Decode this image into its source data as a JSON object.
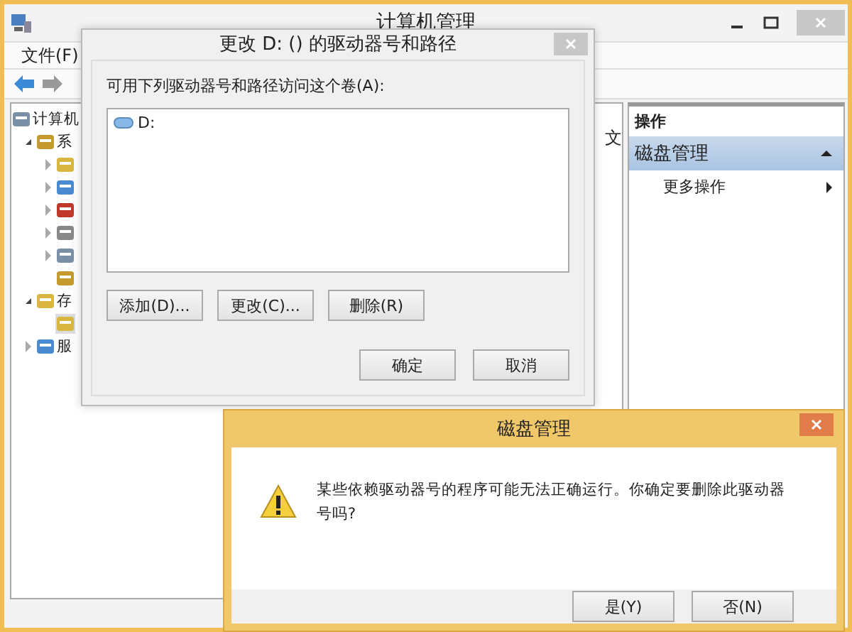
{
  "window": {
    "title": "计算机管理"
  },
  "menu": [
    "文件(F)"
  ],
  "tree": [
    {
      "label": "计算机",
      "children": [
        {
          "label": "系",
          "expanded": true,
          "children": [
            {
              "expanded": false
            },
            {
              "expanded": false
            },
            {
              "expanded": false
            },
            {
              "expanded": false
            },
            {
              "expanded": false
            },
            {
              "selected": false
            }
          ]
        },
        {
          "label": "存",
          "expanded": true,
          "children": [
            {
              "selected": true
            }
          ]
        },
        {
          "label": "服",
          "expanded": false
        }
      ]
    }
  ],
  "middle_text": "文",
  "actions": {
    "header": "操作",
    "section": "磁盘管理",
    "expanded": true,
    "items": [
      "更多操作"
    ]
  },
  "drive_dialog": {
    "title": "更改 D: () 的驱动器号和路径",
    "label": "可用下列驱动器号和路径访问这个卷(A):",
    "entries": [
      {
        "label": "D:",
        "selected": false
      }
    ],
    "buttons": [
      "添加(D)...",
      "更改(C)...",
      "删除(R)"
    ],
    "footer_buttons": [
      "确定",
      "取消"
    ]
  },
  "confirm_dialog": {
    "title": "磁盘管理",
    "message": "某些依赖驱动器号的程序可能无法正确运行。你确定要删除此驱动器号吗?",
    "buttons": [
      "是(Y)",
      "否(N)"
    ]
  }
}
